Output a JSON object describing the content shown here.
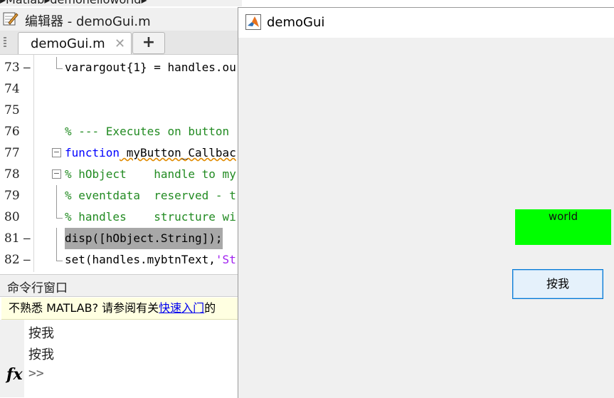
{
  "breadcrumb": {
    "segments": [
      "Matlab",
      "demohelloworld"
    ]
  },
  "editor": {
    "title": "编辑器 - demoGui.m",
    "tabs": [
      {
        "label": "demoGui.m"
      }
    ],
    "add_tab_label": "+",
    "close_glyph": "✕",
    "lines": [
      {
        "num": "73",
        "dash": "—"
      },
      {
        "num": "74",
        "dash": ""
      },
      {
        "num": "75",
        "dash": ""
      },
      {
        "num": "76",
        "dash": ""
      },
      {
        "num": "77",
        "dash": ""
      },
      {
        "num": "78",
        "dash": ""
      },
      {
        "num": "79",
        "dash": ""
      },
      {
        "num": "80",
        "dash": ""
      },
      {
        "num": "81",
        "dash": "—"
      },
      {
        "num": "82",
        "dash": "—"
      }
    ],
    "code": {
      "l73": "varargout{1} = handles.ou",
      "l76": "% --- Executes on button",
      "l77_kw": "function",
      "l77_rest": " myButton_Callbac",
      "l78": "% hObject    handle to my",
      "l79": "% eventdata  reserved - t",
      "l80": "% handles    structure wi",
      "l81": "disp([hObject.String]);",
      "l82_pre": "set(handles.mybtnText,",
      "l82_str": "'St"
    }
  },
  "command_window": {
    "title": "命令行窗口",
    "notice_pre": "不熟悉 MATLAB? 请参阅有关",
    "notice_link": "快速入门",
    "notice_post": "的",
    "outputs": [
      "按我",
      "按我"
    ],
    "fx_label": "fx",
    "prompt": ">>"
  },
  "figure": {
    "title": "demoGui",
    "text_label": "world",
    "button_label": "按我",
    "colors": {
      "text_bg": "#00ff00",
      "button_bg": "#e5f1fb",
      "button_border": "#0078d7"
    }
  },
  "colors": {
    "keyword": "#0000ff",
    "comment": "#228b22",
    "string": "#a020f0",
    "highlight": "#a8a8a8"
  },
  "icons": [
    "editor-icon",
    "close-icon",
    "plus-icon",
    "matlab-logo-icon",
    "fx-icon"
  ]
}
